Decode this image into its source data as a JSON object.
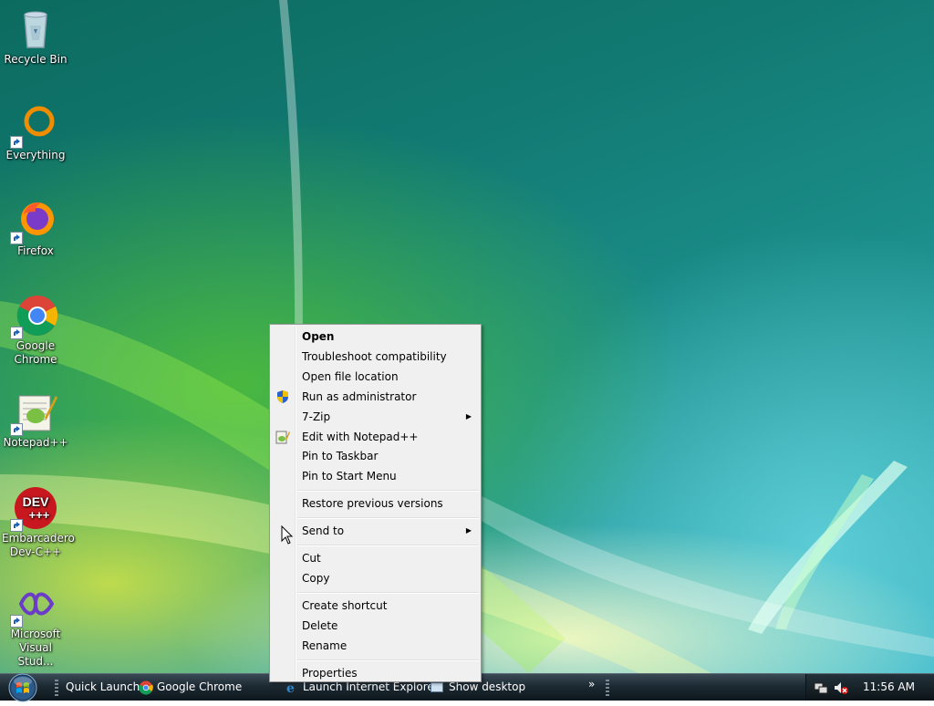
{
  "desktop": {
    "icons": [
      {
        "label": "Recycle Bin",
        "icon": "recycle-bin-icon"
      },
      {
        "label": "Everything",
        "icon": "everything-icon"
      },
      {
        "label": "Firefox",
        "icon": "firefox-icon"
      },
      {
        "label": "Google Chrome",
        "icon": "chrome-icon"
      },
      {
        "label": "Notepad++",
        "icon": "notepad-plus-plus-icon"
      },
      {
        "label": "Embarcadero Dev-C++",
        "icon": "dev-cpp-icon",
        "logo_text": "DEV\n+++"
      },
      {
        "label": "Microsoft Visual Stud...",
        "icon": "visual-studio-icon"
      }
    ]
  },
  "context_menu": {
    "items": [
      {
        "label": "Open",
        "bold": true
      },
      {
        "label": "Troubleshoot compatibility"
      },
      {
        "label": "Open file location"
      },
      {
        "label": "Run as administrator",
        "icon": "uac-shield-icon"
      },
      {
        "label": "7-Zip",
        "submenu": true
      },
      {
        "label": "Edit with Notepad++",
        "icon": "notepad-plus-plus-icon"
      },
      {
        "label": "Pin to Taskbar"
      },
      {
        "label": "Pin to Start Menu"
      },
      {
        "label": "Restore previous versions"
      },
      {
        "label": "Send to",
        "submenu": true
      },
      {
        "label": "Cut"
      },
      {
        "label": "Copy"
      },
      {
        "label": "Create shortcut"
      },
      {
        "label": "Delete"
      },
      {
        "label": "Rename"
      },
      {
        "label": "Properties"
      }
    ],
    "submenu_glyph": "▶"
  },
  "taskbar": {
    "quick_launch_label": "Quick Launch",
    "chrome_label": "Google Chrome",
    "ie_label": "Launch Internet Explore...",
    "show_desktop_label": "Show desktop",
    "overflow_glyph": "»",
    "clock": "11:56 AM"
  },
  "colors": {
    "menu_bg": "#f0f0f0",
    "menu_border": "#979797",
    "taskbar_top": "#3a4a55",
    "taskbar_bottom": "#0d161c",
    "desktop_teal": "#1b8d89",
    "desktop_green": "#5ac828",
    "desktop_yellow": "#f0f03c"
  }
}
